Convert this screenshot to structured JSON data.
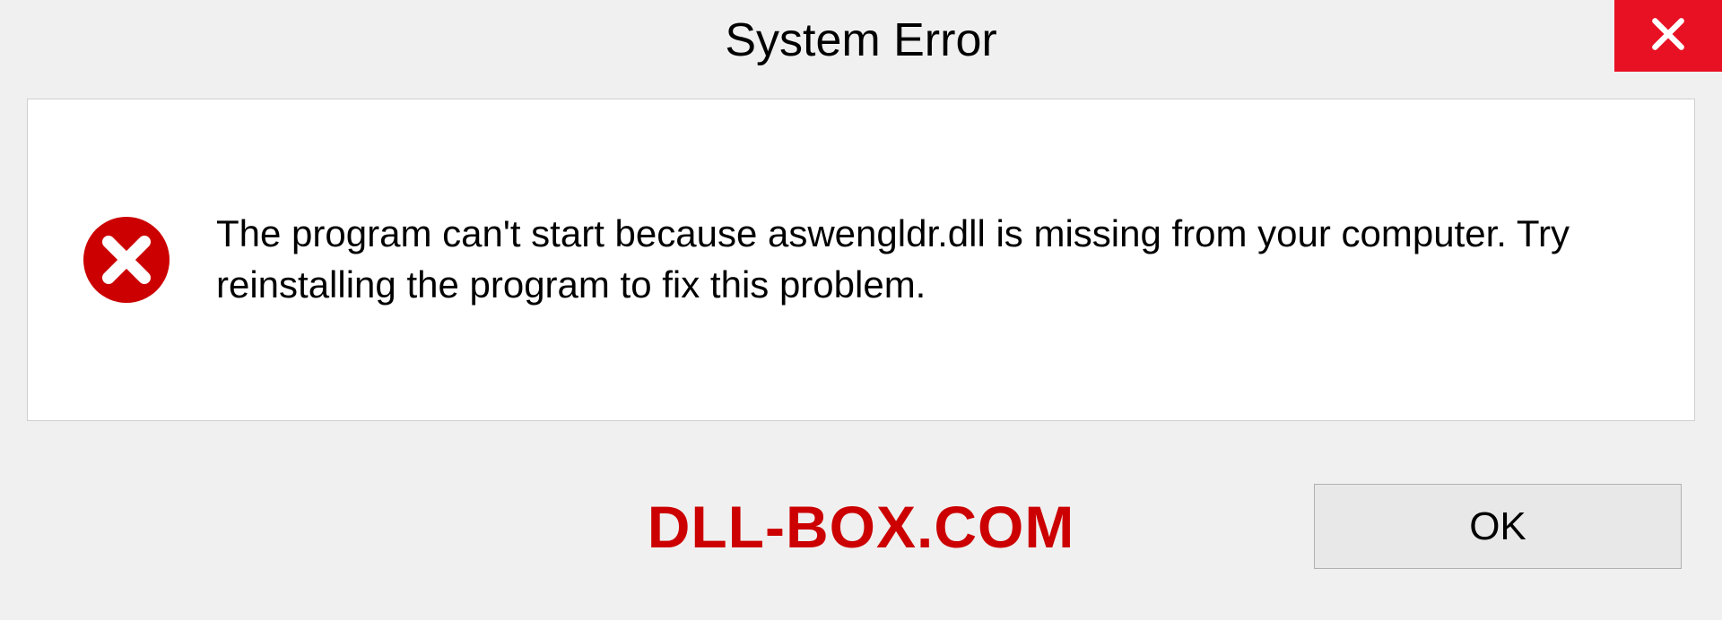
{
  "dialog": {
    "title": "System Error",
    "message": "The program can't start because aswengldr.dll is missing from your computer. Try reinstalling the program to fix this problem.",
    "ok_label": "OK"
  },
  "watermark": "DLL-BOX.COM",
  "colors": {
    "close_bg": "#e81123",
    "error_icon": "#cc0000",
    "watermark": "#cc0000"
  }
}
